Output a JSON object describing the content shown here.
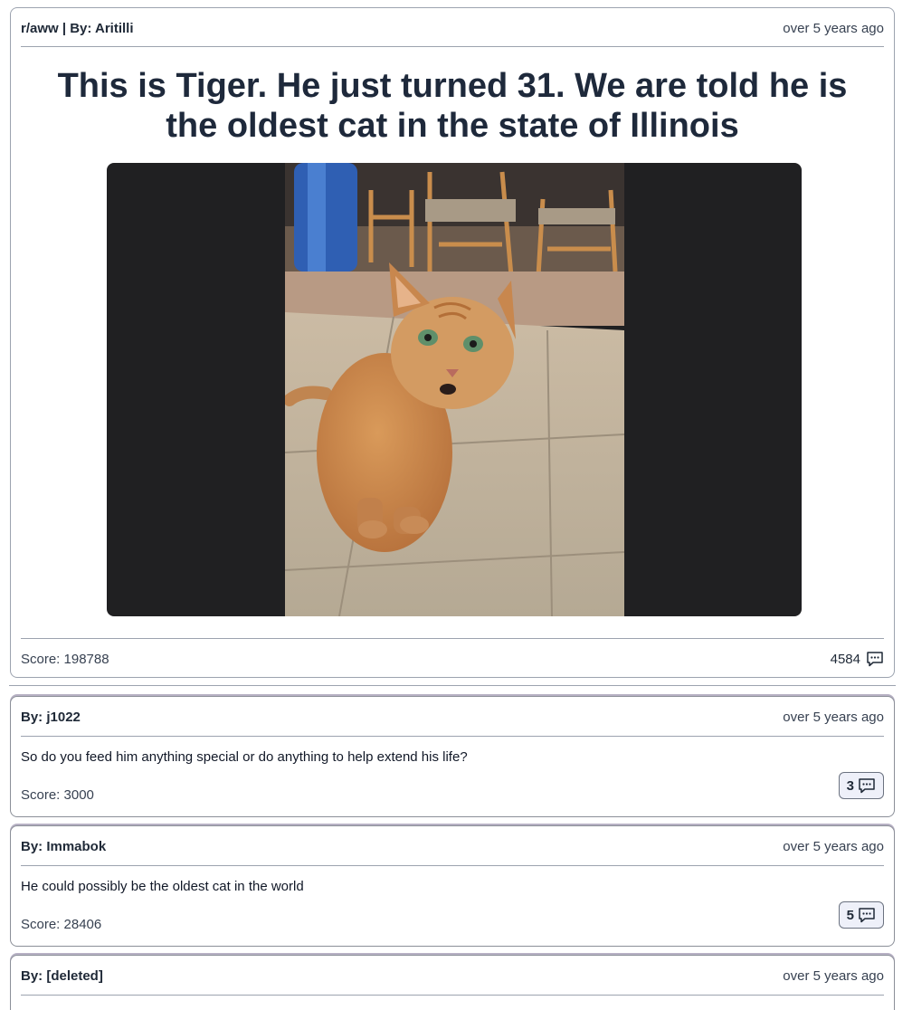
{
  "post": {
    "meta": "r/aww | By: Aritilli",
    "time": "over 5 years ago",
    "title": "This is Tiger. He just turned 31. We are told he is the oldest cat in the state of Illinois",
    "score": "Score: 198788",
    "comment_count": "4584"
  },
  "comments": [
    {
      "author": "By: j1022",
      "time": "over 5 years ago",
      "body": "So do you feed him anything special or do anything to help extend his life?",
      "score": "Score: 3000",
      "replies": "3"
    },
    {
      "author": "By: Immabok",
      "time": "over 5 years ago",
      "body": "He could possibly be the oldest cat in the world",
      "score": "Score: 28406",
      "replies": "5"
    },
    {
      "author": "By: [deleted]",
      "time": "over 5 years ago"
    }
  ],
  "colors": {
    "media_background": "#202022",
    "reply_button_bg": "#eef0f9"
  },
  "icons": {
    "comment": "comment-bubble-icon"
  }
}
